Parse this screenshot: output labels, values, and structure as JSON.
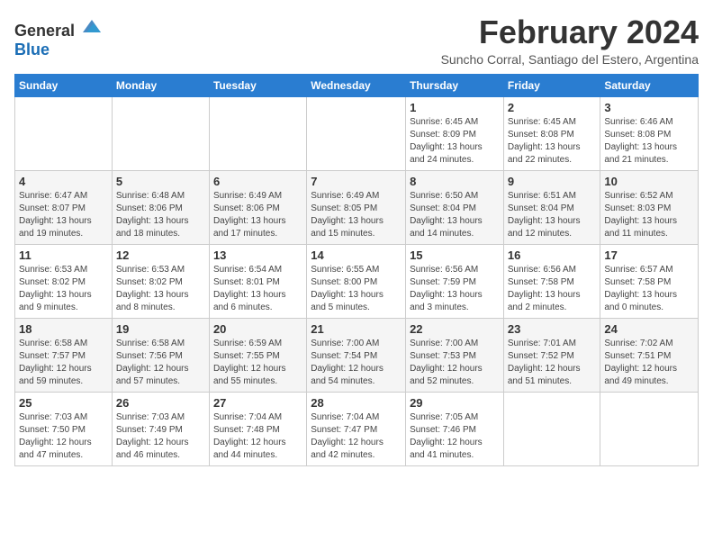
{
  "header": {
    "logo_general": "General",
    "logo_blue": "Blue",
    "title": "February 2024",
    "location": "Suncho Corral, Santiago del Estero, Argentina"
  },
  "weekdays": [
    "Sunday",
    "Monday",
    "Tuesday",
    "Wednesday",
    "Thursday",
    "Friday",
    "Saturday"
  ],
  "weeks": [
    [
      {
        "day": "",
        "info": ""
      },
      {
        "day": "",
        "info": ""
      },
      {
        "day": "",
        "info": ""
      },
      {
        "day": "",
        "info": ""
      },
      {
        "day": "1",
        "info": "Sunrise: 6:45 AM\nSunset: 8:09 PM\nDaylight: 13 hours\nand 24 minutes."
      },
      {
        "day": "2",
        "info": "Sunrise: 6:45 AM\nSunset: 8:08 PM\nDaylight: 13 hours\nand 22 minutes."
      },
      {
        "day": "3",
        "info": "Sunrise: 6:46 AM\nSunset: 8:08 PM\nDaylight: 13 hours\nand 21 minutes."
      }
    ],
    [
      {
        "day": "4",
        "info": "Sunrise: 6:47 AM\nSunset: 8:07 PM\nDaylight: 13 hours\nand 19 minutes."
      },
      {
        "day": "5",
        "info": "Sunrise: 6:48 AM\nSunset: 8:06 PM\nDaylight: 13 hours\nand 18 minutes."
      },
      {
        "day": "6",
        "info": "Sunrise: 6:49 AM\nSunset: 8:06 PM\nDaylight: 13 hours\nand 17 minutes."
      },
      {
        "day": "7",
        "info": "Sunrise: 6:49 AM\nSunset: 8:05 PM\nDaylight: 13 hours\nand 15 minutes."
      },
      {
        "day": "8",
        "info": "Sunrise: 6:50 AM\nSunset: 8:04 PM\nDaylight: 13 hours\nand 14 minutes."
      },
      {
        "day": "9",
        "info": "Sunrise: 6:51 AM\nSunset: 8:04 PM\nDaylight: 13 hours\nand 12 minutes."
      },
      {
        "day": "10",
        "info": "Sunrise: 6:52 AM\nSunset: 8:03 PM\nDaylight: 13 hours\nand 11 minutes."
      }
    ],
    [
      {
        "day": "11",
        "info": "Sunrise: 6:53 AM\nSunset: 8:02 PM\nDaylight: 13 hours\nand 9 minutes."
      },
      {
        "day": "12",
        "info": "Sunrise: 6:53 AM\nSunset: 8:02 PM\nDaylight: 13 hours\nand 8 minutes."
      },
      {
        "day": "13",
        "info": "Sunrise: 6:54 AM\nSunset: 8:01 PM\nDaylight: 13 hours\nand 6 minutes."
      },
      {
        "day": "14",
        "info": "Sunrise: 6:55 AM\nSunset: 8:00 PM\nDaylight: 13 hours\nand 5 minutes."
      },
      {
        "day": "15",
        "info": "Sunrise: 6:56 AM\nSunset: 7:59 PM\nDaylight: 13 hours\nand 3 minutes."
      },
      {
        "day": "16",
        "info": "Sunrise: 6:56 AM\nSunset: 7:58 PM\nDaylight: 13 hours\nand 2 minutes."
      },
      {
        "day": "17",
        "info": "Sunrise: 6:57 AM\nSunset: 7:58 PM\nDaylight: 13 hours\nand 0 minutes."
      }
    ],
    [
      {
        "day": "18",
        "info": "Sunrise: 6:58 AM\nSunset: 7:57 PM\nDaylight: 12 hours\nand 59 minutes."
      },
      {
        "day": "19",
        "info": "Sunrise: 6:58 AM\nSunset: 7:56 PM\nDaylight: 12 hours\nand 57 minutes."
      },
      {
        "day": "20",
        "info": "Sunrise: 6:59 AM\nSunset: 7:55 PM\nDaylight: 12 hours\nand 55 minutes."
      },
      {
        "day": "21",
        "info": "Sunrise: 7:00 AM\nSunset: 7:54 PM\nDaylight: 12 hours\nand 54 minutes."
      },
      {
        "day": "22",
        "info": "Sunrise: 7:00 AM\nSunset: 7:53 PM\nDaylight: 12 hours\nand 52 minutes."
      },
      {
        "day": "23",
        "info": "Sunrise: 7:01 AM\nSunset: 7:52 PM\nDaylight: 12 hours\nand 51 minutes."
      },
      {
        "day": "24",
        "info": "Sunrise: 7:02 AM\nSunset: 7:51 PM\nDaylight: 12 hours\nand 49 minutes."
      }
    ],
    [
      {
        "day": "25",
        "info": "Sunrise: 7:03 AM\nSunset: 7:50 PM\nDaylight: 12 hours\nand 47 minutes."
      },
      {
        "day": "26",
        "info": "Sunrise: 7:03 AM\nSunset: 7:49 PM\nDaylight: 12 hours\nand 46 minutes."
      },
      {
        "day": "27",
        "info": "Sunrise: 7:04 AM\nSunset: 7:48 PM\nDaylight: 12 hours\nand 44 minutes."
      },
      {
        "day": "28",
        "info": "Sunrise: 7:04 AM\nSunset: 7:47 PM\nDaylight: 12 hours\nand 42 minutes."
      },
      {
        "day": "29",
        "info": "Sunrise: 7:05 AM\nSunset: 7:46 PM\nDaylight: 12 hours\nand 41 minutes."
      },
      {
        "day": "",
        "info": ""
      },
      {
        "day": "",
        "info": ""
      }
    ]
  ]
}
